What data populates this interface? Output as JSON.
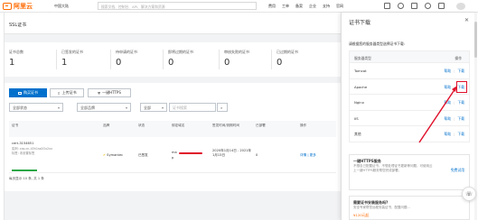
{
  "topbar": {
    "brand": "阿里云",
    "region": "中国大陆",
    "search_placeholder": "搜索文档、控制台、API、解决方案和资源",
    "nav": [
      "费用",
      "工单",
      "备案",
      "企业",
      "支持",
      "官网"
    ]
  },
  "page": {
    "title": "SSL证书"
  },
  "stats": [
    {
      "label": "证书总数",
      "value": "1"
    },
    {
      "label": "已签发的证书",
      "value": "1"
    },
    {
      "label": "待申请的证书",
      "value": "0"
    },
    {
      "label": "即将过期的证书",
      "value": "0"
    },
    {
      "label": "审核失败的证书",
      "value": "0"
    },
    {
      "label": "已过期的证书",
      "value": "0"
    }
  ],
  "toolbar": {
    "buy": "购买证书",
    "upload": "上传证书",
    "https": "一键HTTPS",
    "filter_status": "全部状态",
    "filter_brand": "全部品牌",
    "filter_type": "全部",
    "search_placeholder": "证书搜索"
  },
  "table": {
    "headers": [
      "证书",
      "品牌",
      "状态",
      "绑定域名",
      "签发时间/到期时间",
      "已部署",
      "操作"
    ],
    "row": {
      "name": "cert-3154651",
      "sub1": "实例: cas-cn-45h1ss0Ox2xx",
      "sub2": "标签: 未设置标签",
      "brand": "Symantec",
      "status": "已签发",
      "domain": "ma",
      "domain2": "p",
      "dates": "2020年1月14日 - 2021年1月13日",
      "deployed": "0",
      "actions": "详情  |  更多"
    }
  },
  "pager": "每页显示 10 条, 共 1 条",
  "drawer": {
    "title": "证书下载",
    "intro": "请根据您的服务器类型选择证书下载:",
    "col_server": "服务器类型",
    "col_action": "操作",
    "help": "帮助",
    "download": "下载",
    "servers": [
      "Tomcat",
      "Apache",
      "Nginx",
      "IIS",
      "其他"
    ],
    "card1_title": "一键HTTPS服务",
    "card1_desc": "不想自己配置证书，不想处理证书更新等问题，可使用云上一键HTTPS服务帮您完成部署。",
    "card1_action": "免费试用",
    "card2_title": "需要证书安装服务吗?",
    "card2_desc": "安全专家帮您远程安装证书，配置问题...",
    "card2_price": "¥120元起"
  },
  "colors": {
    "brand": "#ff6a00",
    "link": "#0070cc",
    "highlight": "#e0102a"
  }
}
